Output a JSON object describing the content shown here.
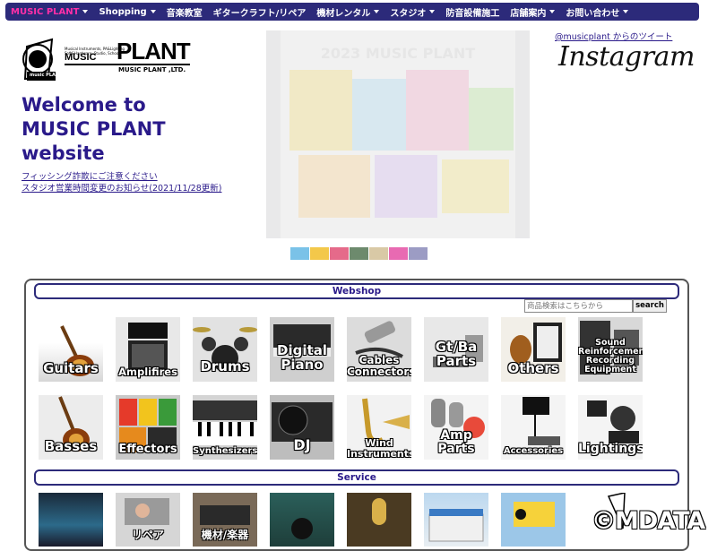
{
  "nav": {
    "items": [
      {
        "label": "MUSIC PLANT",
        "caret": true,
        "active": true
      },
      {
        "label": "Shopping",
        "caret": true
      },
      {
        "label": "音楽教室",
        "caret": false
      },
      {
        "label": "ギタークラフト/リペア",
        "caret": false
      },
      {
        "label": "機材レンタル",
        "caret": true
      },
      {
        "label": "スタジオ",
        "caret": true
      },
      {
        "label": "防音設備施工",
        "caret": false
      },
      {
        "label": "店舗案内",
        "caret": true
      },
      {
        "label": "お問い合わせ",
        "caret": true
      }
    ]
  },
  "logo": {
    "line1": "Musical Instruments, PA&Lighting",
    "line2": "Soft&Hardware, Studio, School",
    "brand_music": "MUSIC",
    "brand_plant": "PLANT",
    "company": "MUSIC PLANT ,LTD.",
    "badge": "music PLANT"
  },
  "welcome": {
    "line1": "Welcome to",
    "line2": "MUSIC PLANT",
    "line3": "website"
  },
  "notices": [
    "フィッシング詐欺にご注意ください",
    "スタジオ営業時間変更のお知らせ(2021/11/28更新)"
  ],
  "banner": {
    "title": "2023 MUSIC PLANT"
  },
  "social": {
    "twitter_link": "@musicplant からのツイート",
    "instagram": "Instagram"
  },
  "webshop": {
    "title": "Webshop",
    "search_placeholder": "商品検索はこちらから",
    "search_button": "search",
    "categories": [
      "Guitars",
      "Amplifires",
      "Drums",
      "Digital Piano",
      "Cables Connectors",
      "Gt/Ba Parts",
      "Others",
      "Sound Reinforcement Recording Equipment",
      "Basses",
      "Effectors",
      "Synthesizers",
      "DJ",
      "Wind Instruments",
      "Amp Parts",
      "Accessories",
      "Lightings"
    ]
  },
  "service": {
    "title": "Service",
    "items": [
      "",
      "リペア",
      "機材/楽器",
      "",
      "",
      "",
      "",
      ""
    ]
  },
  "watermark": "©MDATA"
}
